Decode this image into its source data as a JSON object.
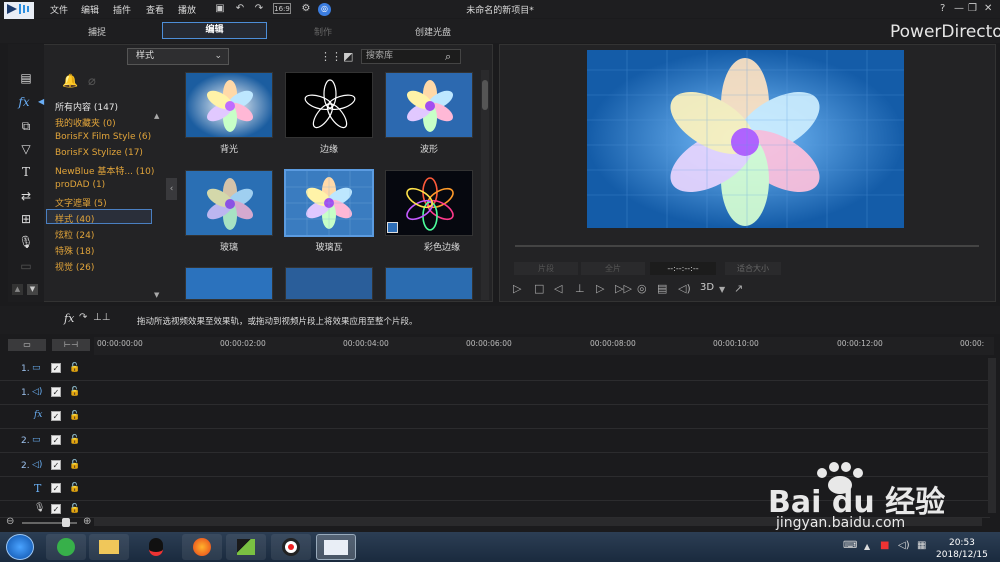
{
  "menu": {
    "file": "文件",
    "edit": "编辑",
    "plugins": "插件",
    "view": "查看",
    "playback": "播放"
  },
  "window_title": "未命名的新项目*",
  "window_btns": {
    "help": "?",
    "min": "—",
    "restore": "❐",
    "close": "✕"
  },
  "modes": {
    "capture": "捕捉",
    "edit": "编辑",
    "produce": "制作",
    "disc": "创建光盘"
  },
  "brand": "PowerDirector",
  "library": {
    "dropdown": "样式",
    "search_placeholder": "搜索库",
    "categories": [
      {
        "label": "所有内容 (147)"
      },
      {
        "label": "我的收藏夹  (0)"
      },
      {
        "label": "BorisFX Film Style  (6)"
      },
      {
        "label": "BorisFX Stylize  (17)"
      },
      {
        "label": "NewBlue 基本特... (10)"
      },
      {
        "label": "proDAD  (1)"
      },
      {
        "label": "文字遮罩  (5)"
      },
      {
        "label": "样式  (40)"
      },
      {
        "label": "炫粒  (24)"
      },
      {
        "label": "特殊  (18)"
      },
      {
        "label": "视觉  (26)"
      }
    ],
    "effects": [
      {
        "label": "背光"
      },
      {
        "label": "边缘"
      },
      {
        "label": "波形"
      },
      {
        "label": "玻璃"
      },
      {
        "label": "玻璃瓦"
      },
      {
        "label": "彩色边缘"
      }
    ]
  },
  "preview": {
    "btn_clip": "片段",
    "btn_movie": "全片",
    "timecode": "--:--:--:--",
    "fit": "适合大小",
    "threed": "3D"
  },
  "hint": "拖动所选视频效果至效果轨，或拖动到视频片段上将效果应用至整个片段。",
  "timeline": {
    "ticks": [
      "00:00:00:00",
      "00:00:02:00",
      "00:00:04:00",
      "00:00:06:00",
      "00:00:08:00",
      "00:00:10:00",
      "00:00:12:00",
      "00:00:"
    ],
    "tracks": [
      {
        "label": "1."
      },
      {
        "label": "1."
      },
      {
        "label": ""
      },
      {
        "label": "2."
      },
      {
        "label": "2."
      },
      {
        "label": ""
      },
      {
        "label": ""
      }
    ]
  },
  "taskbar": {
    "time": "20:53",
    "date": "2018/12/15"
  },
  "watermark": {
    "brand": "Bai du 经验",
    "url": "jingyan.baidu.com"
  }
}
